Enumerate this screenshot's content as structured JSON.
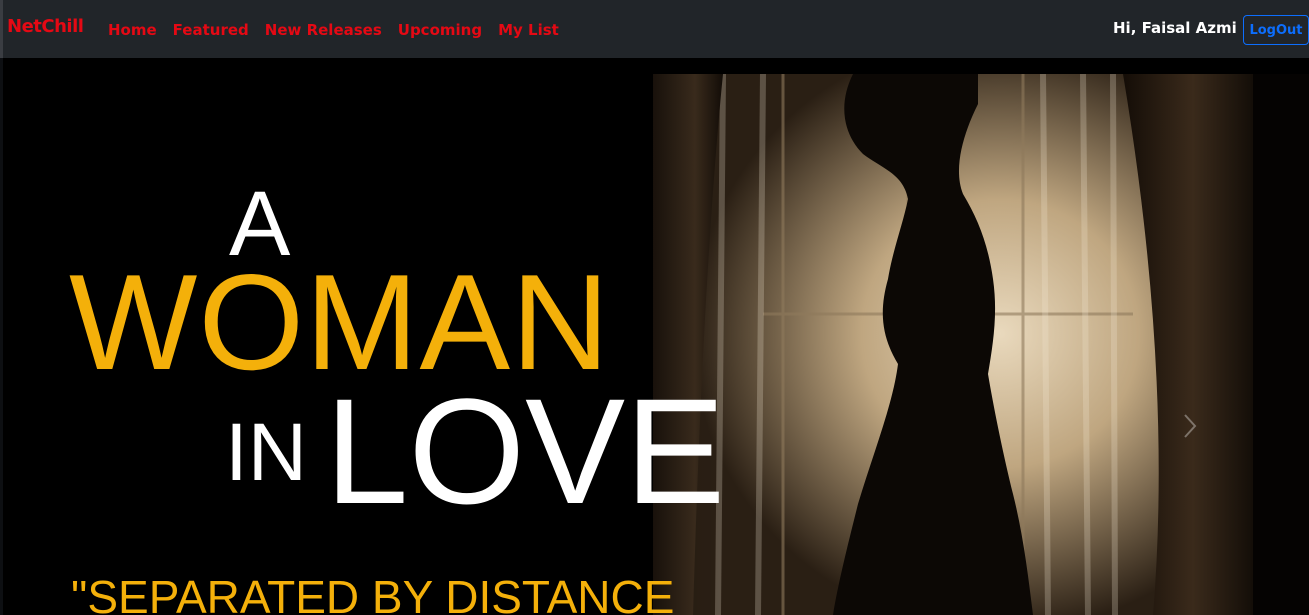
{
  "navbar": {
    "brand": "NetChill",
    "links": [
      "Home",
      "Featured",
      "New Releases",
      "Upcoming",
      "My List"
    ],
    "greeting": "Hi, Faisal Azmi",
    "logout_label": "LogOut"
  },
  "hero": {
    "title_a": "A",
    "title_woman": "WOMAN",
    "title_in": "IN",
    "title_love": "LOVE",
    "tagline": "\"SEPARATED BY DISTANCE"
  },
  "colors": {
    "brand_red": "#e50914",
    "navbar_bg": "#212529",
    "title_gold": "#f4b00a",
    "logout_blue": "#0d6efd"
  },
  "icons": {
    "carousel_next": "chevron-right-icon"
  }
}
